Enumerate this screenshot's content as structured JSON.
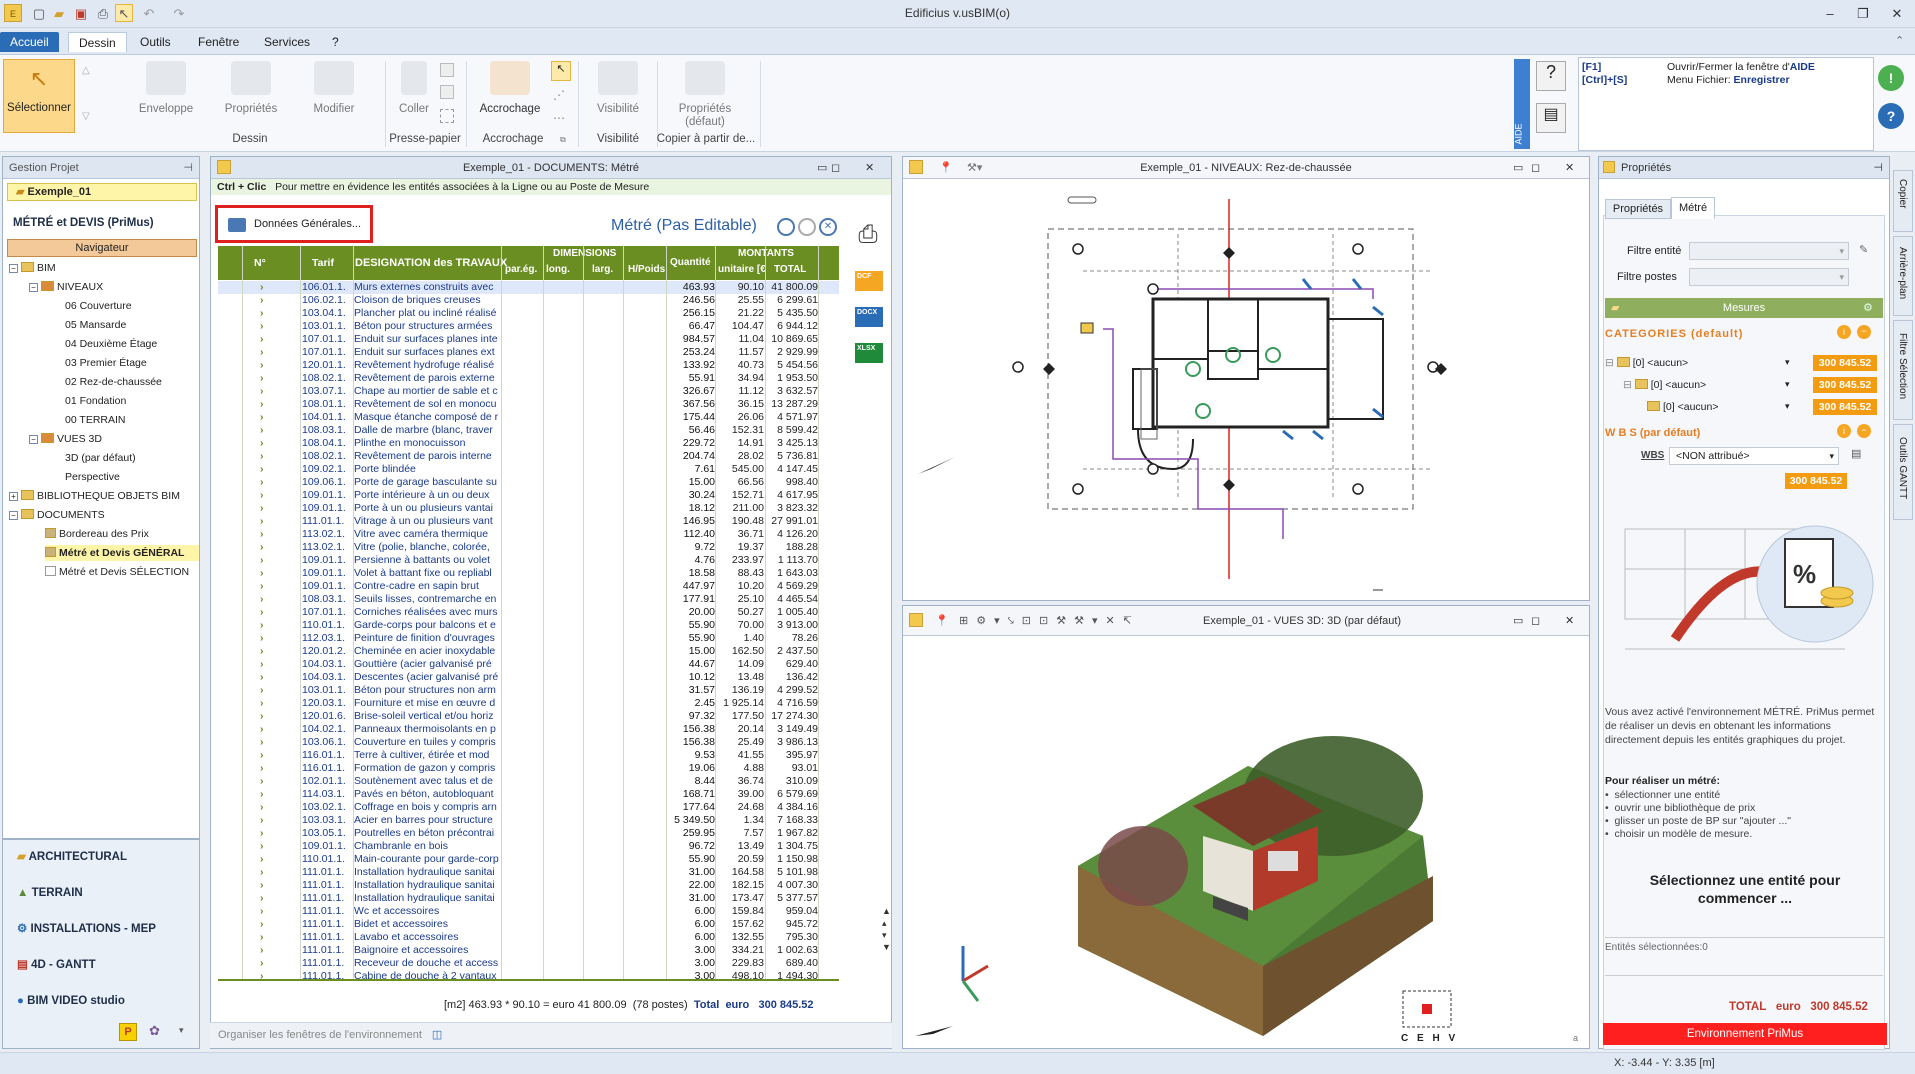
{
  "app": {
    "title": "Edificius v.usBIM(o)"
  },
  "menu": {
    "items": [
      "Accueil",
      "Dessin",
      "Outils",
      "Fenêtre",
      "Services",
      "?"
    ]
  },
  "ribbon": {
    "select_label": "Sélectionner",
    "buttons": [
      "Enveloppe",
      "Propriétés",
      "Modifier",
      "Coller",
      "Accrochage",
      "Visibilité",
      "Propriétés (défaut)"
    ],
    "groups": [
      "Dessin",
      "Presse-papier",
      "Accrochage",
      "Visibilité",
      "Copier à partir de..."
    ],
    "help_side": "AIDE",
    "shortcuts": [
      {
        "key": "[F1]",
        "text": "Ouvrir/Fermer la fenêtre d'",
        "bold": "AIDE"
      },
      {
        "key": "[Ctrl]+[S]",
        "text": "Menu Fichier: ",
        "bold": "Enregistrer"
      }
    ]
  },
  "project": {
    "panel_title": "Gestion Projet",
    "name": "Exemple_01",
    "section": "MÉTRÉ et DEVIS (PriMus)",
    "navigator": "Navigateur",
    "tree": [
      "BIM",
      "NIVEAUX",
      "06 Couverture",
      "05 Mansarde",
      "04 Deuxième Étage",
      "03 Premier Étage",
      "02 Rez-de-chaussée",
      "01 Fondation",
      "00 TERRAIN",
      "VUES 3D",
      "3D (par défaut)",
      "Perspective",
      "BIBLIOTHEQUE OBJETS BIM",
      "DOCUMENTS",
      "Bordereau des Prix",
      "Métré et Devis GÉNÉRAL",
      "Métré et Devis SÉLECTION"
    ],
    "nav_sections": [
      "ARCHITECTURAL",
      "TERRAIN",
      "INSTALLATIONS - MEP",
      "4D - GANTT",
      "BIM VIDEO studio"
    ]
  },
  "doc": {
    "title": "Exemple_01 - DOCUMENTS: Métré",
    "hint_bold": "Ctrl + Clic",
    "hint": "Pour mettre en évidence les entités associées à la Ligne ou au Poste de Mesure",
    "general_data": "Données Générales...",
    "metre_title": "Métré (Pas Editable)",
    "headers": {
      "n": "N°",
      "tarif": "Tarif",
      "designation": "DESIGNATION des TRAVAUX",
      "dimensions": "DIMENSIONS",
      "pareg": "par.ég.",
      "long": "long.",
      "larg": "larg.",
      "hpoids": "H/Poids",
      "quantite": "Quantité",
      "montants": "MONTANTS",
      "unitaire": "unitaire [€]",
      "total": "TOTAL"
    },
    "export": [
      "DCF",
      "DOCX",
      "XLSX"
    ],
    "rows": [
      [
        "106.01.1.",
        "Murs externes construits avec",
        "463.93",
        "90.10",
        "41 800.09"
      ],
      [
        "106.02.1.",
        "Cloison de briques creuses",
        "246.56",
        "25.55",
        "6 299.61"
      ],
      [
        "103.04.1.",
        "Plancher plat ou incliné réalisé",
        "256.15",
        "21.22",
        "5 435.50"
      ],
      [
        "103.01.1.",
        "Béton pour structures armées",
        "66.47",
        "104.47",
        "6 944.12"
      ],
      [
        "107.01.1.",
        "Enduit sur surfaces planes inte",
        "984.57",
        "11.04",
        "10 869.65"
      ],
      [
        "107.01.1.",
        "Enduit sur surfaces planes ext",
        "253.24",
        "11.57",
        "2 929.99"
      ],
      [
        "120.01.1.",
        "Revêtement hydrofuge réalisé",
        "133.92",
        "40.73",
        "5 454.56"
      ],
      [
        "108.02.1.",
        "Revêtement de parois externe",
        "55.91",
        "34.94",
        "1 953.50"
      ],
      [
        "103.07.1.",
        "Chape au mortier de sable et c",
        "326.67",
        "11.12",
        "3 632.57"
      ],
      [
        "108.01.1.",
        "Revêtement de sol en monocu",
        "367.56",
        "36.15",
        "13 287.29"
      ],
      [
        "104.01.1.",
        "Masque étanche composé de r",
        "175.44",
        "26.06",
        "4 571.97"
      ],
      [
        "108.03.1.",
        "Dalle de marbre (blanc, traver",
        "56.46",
        "152.31",
        "8 599.42"
      ],
      [
        "108.04.1.",
        "Plinthe en monocuisson",
        "229.72",
        "14.91",
        "3 425.13"
      ],
      [
        "108.02.1.",
        "Revêtement de parois interne",
        "204.74",
        "28.02",
        "5 736.81"
      ],
      [
        "109.02.1.",
        "Porte blindée",
        "7.61",
        "545.00",
        "4 147.45"
      ],
      [
        "109.06.1.",
        "Porte de garage basculante su",
        "15.00",
        "66.56",
        "998.40"
      ],
      [
        "109.01.1.",
        "Porte intérieure à un ou deux",
        "30.24",
        "152.71",
        "4 617.95"
      ],
      [
        "109.01.1.",
        "Porte à un ou plusieurs vantai",
        "18.12",
        "211.00",
        "3 823.32"
      ],
      [
        "111.01.1.",
        "Vitrage à un ou plusieurs vant",
        "146.95",
        "190.48",
        "27 991.01"
      ],
      [
        "113.02.1.",
        "Vitre avec caméra thermique",
        "112.40",
        "36.71",
        "4 126.20"
      ],
      [
        "113.02.1.",
        "Vitre (polie, blanche, colorée,",
        "9.72",
        "19.37",
        "188.28"
      ],
      [
        "109.01.1.",
        "Persienne à battants ou volet",
        "4.76",
        "233.97",
        "1 113.70"
      ],
      [
        "109.01.1.",
        "Volet à battant fixe ou repliabl",
        "18.58",
        "88.43",
        "1 643.03"
      ],
      [
        "109.01.1.",
        "Contre-cadre en sapin brut",
        "447.97",
        "10.20",
        "4 569.29"
      ],
      [
        "108.03.1.",
        "Seuils lisses, contremarche en",
        "177.91",
        "25.10",
        "4 465.54"
      ],
      [
        "107.01.1.",
        "Corniches réalisées avec murs",
        "20.00",
        "50.27",
        "1 005.40"
      ],
      [
        "110.01.1.",
        "Garde-corps pour balcons et e",
        "55.90",
        "70.00",
        "3 913.00"
      ],
      [
        "112.03.1.",
        "Peinture de finition d'ouvrages",
        "55.90",
        "1.40",
        "78.26"
      ],
      [
        "120.01.2.",
        "Cheminée en acier inoxydable",
        "15.00",
        "162.50",
        "2 437.50"
      ],
      [
        "104.03.1.",
        "Gouttière (acier galvanisé pré",
        "44.67",
        "14.09",
        "629.40"
      ],
      [
        "104.03.1.",
        "Descentes (acier galvanisé pré",
        "10.12",
        "13.48",
        "136.42"
      ],
      [
        "103.01.1.",
        "Béton pour structures non arm",
        "31.57",
        "136.19",
        "4 299.52"
      ],
      [
        "120.03.1.",
        "Fourniture et mise en œuvre d",
        "2.45",
        "1 925.14",
        "4 716.59"
      ],
      [
        "120.01.6.",
        "Brise-soleil vertical et/ou horiz",
        "97.32",
        "177.50",
        "17 274.30"
      ],
      [
        "104.02.1.",
        "Panneaux thermoisolants en p",
        "156.38",
        "20.14",
        "3 149.49"
      ],
      [
        "103.06.1.",
        "Couverture en tuiles y compris",
        "156.38",
        "25.49",
        "3 986.13"
      ],
      [
        "116.01.1.",
        "Terre à cultiver, étirée et mod",
        "9.53",
        "41.55",
        "395.97"
      ],
      [
        "116.01.1.",
        "Formation de gazon y compris",
        "19.06",
        "4.88",
        "93.01"
      ],
      [
        "102.01.1.",
        "Soutènement avec talus et de",
        "8.44",
        "36.74",
        "310.09"
      ],
      [
        "114.03.1.",
        "Pavés en béton, autobloquant",
        "168.71",
        "39.00",
        "6 579.69"
      ],
      [
        "103.02.1.",
        "Coffrage en bois y compris arn",
        "177.64",
        "24.68",
        "4 384.16"
      ],
      [
        "103.03.1.",
        "Acier en barres pour structure",
        "5 349.50",
        "1.34",
        "7 168.33"
      ],
      [
        "103.05.1.",
        "Poutrelles en béton précontrai",
        "259.95",
        "7.57",
        "1 967.82"
      ],
      [
        "109.01.1.",
        "Chambranle en bois",
        "96.72",
        "13.49",
        "1 304.75"
      ],
      [
        "110.01.1.",
        "Main-courante pour garde-corp",
        "55.90",
        "20.59",
        "1 150.98"
      ],
      [
        "111.01.1.",
        "Installation hydraulique sanitai",
        "31.00",
        "164.58",
        "5 101.98"
      ],
      [
        "111.01.1.",
        "Installation hydraulique sanitai",
        "22.00",
        "182.15",
        "4 007.30"
      ],
      [
        "111.01.1.",
        "Installation hydraulique sanitai",
        "31.00",
        "173.47",
        "5 377.57"
      ],
      [
        "111.01.1.",
        "Wc et accessoires",
        "6.00",
        "159.84",
        "959.04"
      ],
      [
        "111.01.1.",
        "Bidet et accessoires",
        "6.00",
        "157.62",
        "945.72"
      ],
      [
        "111.01.1.",
        "Lavabo et accessoires",
        "6.00",
        "132.55",
        "795.30"
      ],
      [
        "111.01.1.",
        "Baignoire et accessoires",
        "3.00",
        "334.21",
        "1 002.63"
      ],
      [
        "111.01.1.",
        "Receveur de douche et access",
        "3.00",
        "229.83",
        "689.40"
      ],
      [
        "111.01.1.",
        "Cabine de douche à 2 vantaux",
        "3.00",
        "498.10",
        "1 494.30"
      ]
    ],
    "footer_formula": "[m2] 463.93 * 90.10 = euro 41 800.09",
    "footer_count": "(78 postes)",
    "footer_total_label": "Total",
    "footer_currency": "euro",
    "footer_total": "300 845.52",
    "bottom": "Organiser les fenêtres de l'environnement"
  },
  "plan": {
    "title": "Exemple_01 - NIVEAUX: Rez-de-chaussée"
  },
  "view3d": {
    "title": "Exemple_01 - VUES 3D: 3D (par défaut)",
    "cube": "C E H V"
  },
  "props": {
    "panel_title": "Propriétés",
    "tabs": [
      "Propriétés",
      "Métré"
    ],
    "filtre_entite": "Filtre entité",
    "filtre_postes": "Filtre postes",
    "mesures": "Mesures",
    "categories": "CATEGORIES (default)",
    "cat_rows": [
      {
        "label": "[0] <aucun>",
        "value": "300 845.52"
      },
      {
        "label": "[0] <aucun>",
        "value": "300 845.52"
      },
      {
        "label": "[0] <aucun>",
        "value": "300 845.52"
      }
    ],
    "wbs": "W B S (par défaut)",
    "wbs_label": "WBS",
    "wbs_value": "<NON attribué>",
    "wbs_total": "300 845.52",
    "info1": "Vous avez activé l'environnement MÉTRÉ. PriMus permet de réaliser un devis en obtenant les informations directement depuis les entités graphiques du projet.",
    "info_title": "Pour réaliser un métré:",
    "bullets": [
      "sélectionner une entité",
      "ouvrir une bibliothèque de prix",
      "glisser un poste de BP sur \"ajouter ...\"",
      "choisir un modèle de mesure."
    ],
    "select_msg": "Sélectionnez une entité pour commencer ...",
    "selected_count": "Entités sélectionnées:0",
    "total_label": "TOTAL",
    "total_currency": "euro",
    "total_value": "300 845.52",
    "env": "Environnement PriMus"
  },
  "sidetabs": [
    "Copier",
    "Arrière-plan",
    "Filtre Sélection",
    "Outils GANTT"
  ],
  "status": {
    "coords": "X: -3.44 - Y: 3.35 [m]"
  },
  "colors": {
    "accent": "#2b6cb7",
    "olive": "#6b8e23",
    "orange": "#f39c12",
    "red": "#ff1f1f"
  }
}
